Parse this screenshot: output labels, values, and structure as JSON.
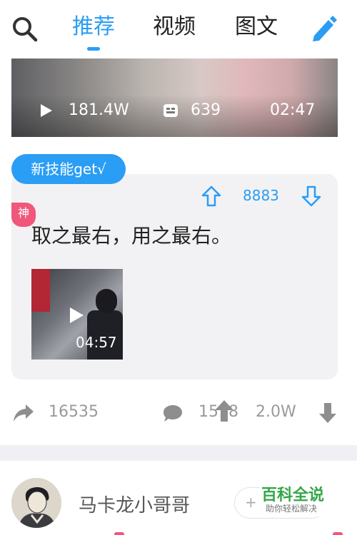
{
  "nav": {
    "tabs": [
      "推荐",
      "视频",
      "图文"
    ],
    "active_tab": 0
  },
  "video_top": {
    "plays": "181.4W",
    "comments": "639",
    "duration": "02:47"
  },
  "tag": {
    "label": "新技能get√"
  },
  "post": {
    "score": "8883",
    "badge": "神",
    "text": "取之最右，用之最右。",
    "video_duration": "04:57"
  },
  "actions": {
    "shares": "16535",
    "comments": "1518",
    "likes": "2.0W"
  },
  "user": {
    "name": "马卡龙小哥哥",
    "follow_symbol": "+"
  },
  "watermark": {
    "title": "百科全说",
    "subtitle": "助你轻松解决"
  },
  "colors": {
    "accent": "#2a9df4",
    "badge": "#f0577b",
    "muted": "#9a9a9a"
  }
}
